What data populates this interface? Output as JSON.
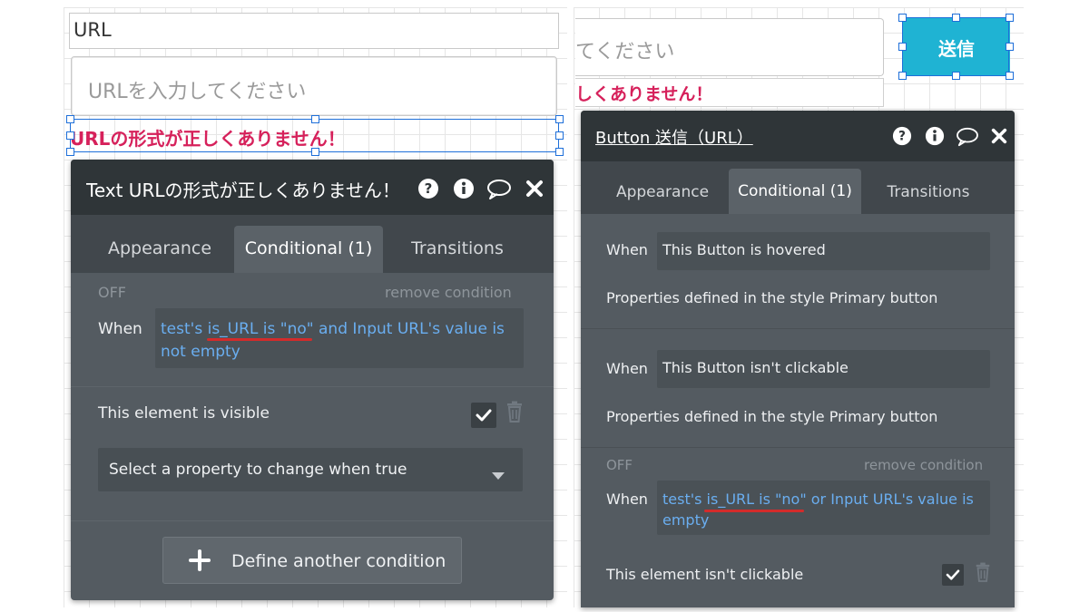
{
  "left": {
    "canvas": {
      "url_label": "URL",
      "input_placeholder": "URLを入力してください",
      "error_text": "URLの形式が正しくありません！"
    },
    "panel": {
      "title": "Text URLの形式が正しくありません！",
      "tabs": [
        "Appearance",
        "Conditional (1)",
        "Transitions"
      ],
      "condition": {
        "status": "OFF",
        "remove_label": "remove condition",
        "when_label": "When",
        "expression_prefix": "test's ",
        "expression_underlined": "is_URL is \"no\"",
        "expression_suffix": " and Input URL's value is not empty",
        "visible_label": "This element is visible",
        "visible_checked": true
      },
      "property_select": "Select a property to change when true",
      "define_button": "Define another condition"
    }
  },
  "right": {
    "canvas": {
      "input_placeholder_partial": "てください",
      "error_partial": "しくありません！",
      "button_label": "送信"
    },
    "panel": {
      "title": "Button 送信（URL）",
      "tabs": [
        "Appearance",
        "Conditional (1)",
        "Transitions"
      ],
      "conditions": [
        {
          "when_label": "When",
          "condition": "This Button is hovered",
          "properties": "Properties defined in the style Primary button"
        },
        {
          "when_label": "When",
          "condition": "This Button isn't clickable",
          "properties": "Properties defined in the style Primary button"
        }
      ],
      "user_condition": {
        "status": "OFF",
        "remove_label": "remove condition",
        "when_label": "When",
        "expression_prefix": "test's ",
        "expression_underlined": "is_URL is \"no\"",
        "expression_suffix": " or Input URL's value is empty",
        "clickable_label": "This element isn't clickable",
        "clickable_checked": true
      }
    }
  },
  "colors": {
    "error_red": "#d6215b",
    "button_teal": "#1fb3d3",
    "expression_blue": "#6aaef0",
    "selection_blue": "#1e6fd9"
  },
  "icons": {
    "help": "question-circle-icon",
    "info": "info-circle-icon",
    "comment": "comment-bubble-icon",
    "close": "close-x-icon",
    "check": "checkmark-icon",
    "trash": "trash-icon",
    "plus": "plus-icon",
    "dropdown": "caret-down-icon"
  }
}
